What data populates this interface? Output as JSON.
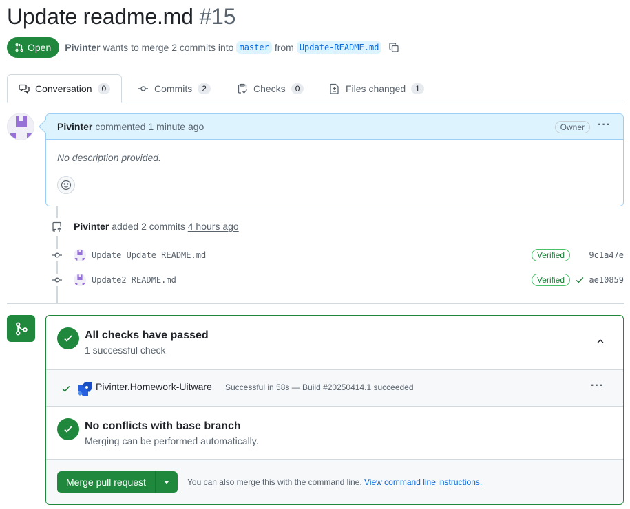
{
  "header": {
    "title": "Update readme.md",
    "number": "#15",
    "state": "Open",
    "author": "Pivinter",
    "wants_text": "wants to merge 2 commits into",
    "base_branch": "master",
    "from_text": "from",
    "head_branch": "Update-README.md"
  },
  "tabs": [
    {
      "label": "Conversation",
      "count": "0"
    },
    {
      "label": "Commits",
      "count": "2"
    },
    {
      "label": "Checks",
      "count": "0"
    },
    {
      "label": "Files changed",
      "count": "1"
    }
  ],
  "comment": {
    "author": "Pivinter",
    "action": "commented 1 minute ago",
    "badge": "Owner",
    "body": "No description provided."
  },
  "push_event": {
    "author": "Pivinter",
    "action": "added 2 commits",
    "time": "4 hours ago"
  },
  "commits": [
    {
      "message": "Update Update README.md",
      "badge": "Verified",
      "sha": "9c1a47e"
    },
    {
      "message": "Update2 README.md",
      "badge": "Verified",
      "sha": "ae10859"
    }
  ],
  "merge": {
    "checks_title": "All checks have passed",
    "checks_sub": "1 successful check",
    "check_name": "Pivinter.Homework-Uitware",
    "check_status": "Successful in 58s — Build #20250414.1 succeeded",
    "conflicts_title": "No conflicts with base branch",
    "conflicts_sub": "Merging can be performed automatically.",
    "merge_button": "Merge pull request",
    "hint_text": "You can also merge this with the command line.",
    "hint_link": "View command line instructions."
  },
  "colors": {
    "accent_green": "#1f883d",
    "link_blue": "#0969da",
    "comment_header": "#ddf4ff"
  }
}
